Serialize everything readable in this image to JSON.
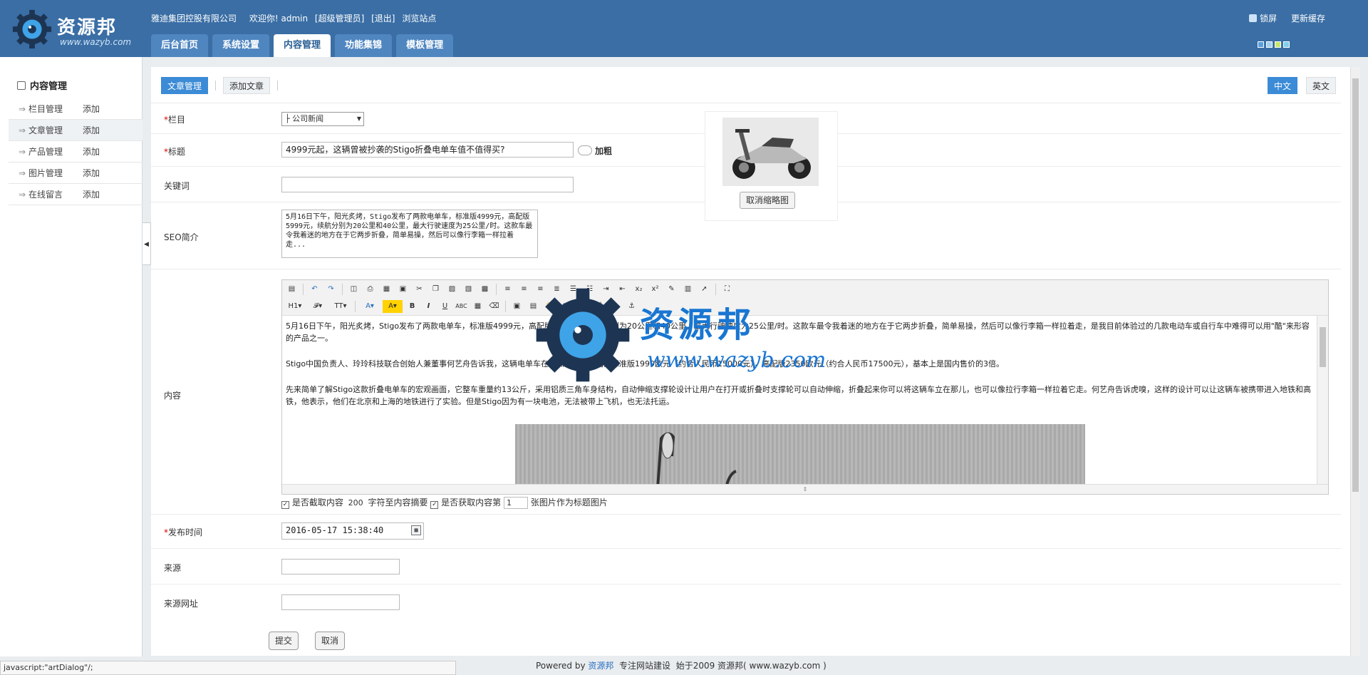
{
  "header": {
    "logo_text": "资源邦",
    "logo_url": "www.wazyb.com",
    "company": "雅迪集团控股有限公司",
    "welcome": "欢迎你! admin",
    "role": "[超级管理员]",
    "logout": "[退出]",
    "browse": "浏览站点",
    "lock": "锁屏",
    "refresh_cache": "更新缓存",
    "nav": [
      {
        "label": "后台首页"
      },
      {
        "label": "系统设置"
      },
      {
        "label": "内容管理"
      },
      {
        "label": "功能集锦"
      },
      {
        "label": "模板管理"
      }
    ],
    "theme_colors": [
      "#5aa0e0",
      "#9fd0f0",
      "#c8e86a",
      "#7ecfe8"
    ]
  },
  "sidebar": {
    "title": "内容管理",
    "items": [
      {
        "label": "栏目管理",
        "action": "添加"
      },
      {
        "label": "文章管理",
        "action": "添加"
      },
      {
        "label": "产品管理",
        "action": "添加"
      },
      {
        "label": "图片管理",
        "action": "添加"
      },
      {
        "label": "在线留言",
        "action": "添加"
      }
    ]
  },
  "main": {
    "subtabs": [
      "文章管理",
      "添加文章"
    ],
    "lang": [
      "中文",
      "英文"
    ],
    "form": {
      "category_label": "栏目",
      "category_value": "├ 公司新闻",
      "title_label": "标题",
      "title_value": "4999元起，这辆曾被抄袭的Stigo折叠电单车值不值得买?",
      "bold_label": "加粗",
      "keywords_label": "关键词",
      "keywords_value": "",
      "seo_label": "SEO简介",
      "seo_value": "5月16日下午，阳光炙烤，Stigo发布了两款电单车，标准版4999元，高配版5999元，续航分别为20公里和40公里，最大行驶速度为25公里/时。这款车最令我着迷的地方在于它两步折叠，简单易操，然后可以像行李箱一样拉着走...",
      "cancel_thumb": "取消缩略图",
      "content_label": "内容",
      "content_paragraphs": [
        "5月16日下午，阳光炙烤，Stigo发布了两款电单车，标准版4999元，高配版5999元，续航分别为20公里和40公里，最大行驶速度为25公里/时。这款车最令我着迷的地方在于它两步折叠，简单易操，然后可以像行李箱一样拉着走，是我目前体验过的几款电动车或自行车中难得可以用\"酷\"来形容的产品之一。",
        "Stigo中国负责人、玲玲科技联合创始人兼董事何艺舟告诉我，这辆电单车在欧洲的定价分别是标准版1999欧元（约合人民币15000元），高配版2350欧元（约合人民币17500元），基本上是国内售价的3倍。",
        "先来简单了解Stigo这款折叠电单车的宏观画面，它整车重量约13公斤，采用铝质三角车身结构，自动伸缩支撑轮设计让用户在打开或折叠时支撑轮可以自动伸缩，折叠起来你可以将这辆车立在那儿，也可以像拉行李箱一样拉着它走。何艺舟告诉虎嗅，这样的设计可以让这辆车被携带进入地铁和高铁，他表示，他们在北京和上海的地铁进行了实验。但是Stigo因为有一块电池，无法被带上飞机，也无法托运。"
      ],
      "opt_extract_label": "是否截取内容",
      "opt_extract_count": "200",
      "opt_extract_suffix": "字符至内容摘要",
      "opt_image_label": "是否获取内容第",
      "opt_image_index": "1",
      "opt_image_suffix": "张图片作为标题图片",
      "pubtime_label": "发布时间",
      "pubtime_value": "2016-05-17 15:38:40",
      "source_label": "来源",
      "source_value": "",
      "source_url_label": "来源网址",
      "source_url_value": "",
      "submit": "提交",
      "cancel": "取消"
    }
  },
  "watermark": {
    "text": "资源邦",
    "url": "www.wazyb.com"
  },
  "statusbar": "javascript:\"artDialog\"/;",
  "footer": {
    "powered": "Powered by",
    "brand": "资源邦",
    "slogan": "专注网站建设",
    "since": "始于2009 资源邦( www.wazyb.com )"
  },
  "colors": {
    "header_bg": "#3a6ea5",
    "accent": "#3b8bd6",
    "watermark": "#1976d2"
  }
}
